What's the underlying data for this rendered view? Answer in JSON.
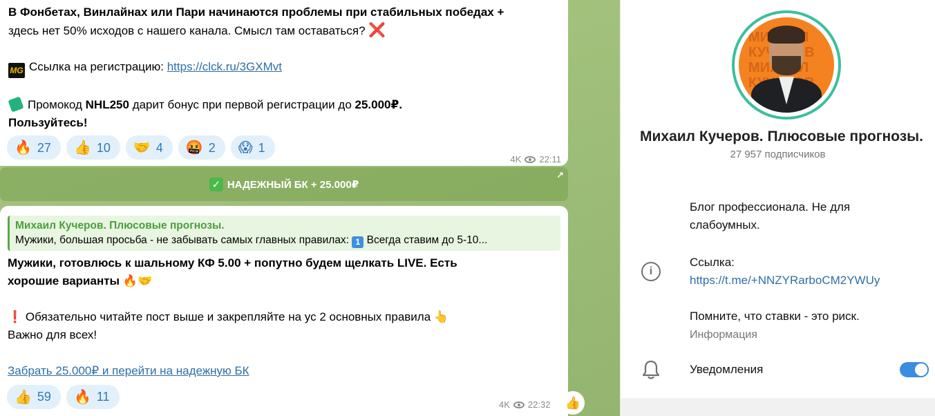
{
  "message1": {
    "line1": "В Фонбетах, Винлайнах или Пари начинаются проблемы при стабильных победах +",
    "line2": "здесь нет 50% исходов с нашего канала. Смысл там оставаться?",
    "cross_icon": "❌",
    "logo_text": "MG",
    "registration_label": "Ссылка на регистрацию:",
    "registration_link": "https://clck.ru/3GXMvt",
    "promo_prefix": "Промокод",
    "promo_code": "NHL250",
    "promo_middle": "дарит бонус при первой регистрации до",
    "promo_amount": "25.000₽.",
    "promo_end": "Пользуйтесь!",
    "reactions": [
      {
        "icon": "🔥",
        "count": "27"
      },
      {
        "icon": "👍",
        "count": "10"
      },
      {
        "icon": "🤝",
        "count": "4"
      },
      {
        "icon": "🤬",
        "count": "2"
      },
      {
        "icon": "😱",
        "count": "1"
      }
    ],
    "views": "4K",
    "time": "22:11"
  },
  "inline_button": {
    "label": "НАДЕЖНЫЙ БК + 25.000₽",
    "check_icon": "✓",
    "arrow_icon": "↗"
  },
  "message2": {
    "reply_author": "Михаил Кучеров. Плюсовые прогнозы.",
    "reply_text_a": "Мужики, большая просьба - не забывать самых главных правилах:",
    "reply_keycap": "1",
    "reply_text_b": "Всегда ставим до 5-10...",
    "line1": "Мужики, готовлюсь к шальному КФ 5.00 + попутно будем щелкать LIVE. Есть",
    "line2": "хорошие варианты",
    "line2_emoji": "🔥🤝",
    "excl_icon": "❗",
    "line3": "Обязательно читайте пост выше и закрепляйте на ус 2 основных правила",
    "line3_emoji": "👆",
    "line4": "Важно для всех!",
    "cta_link": "Забрать 25.000₽ и перейти на надежную БК",
    "reactions": [
      {
        "icon": "👍",
        "count": "59"
      },
      {
        "icon": "🔥",
        "count": "11"
      }
    ],
    "views": "4K",
    "time": "22:32",
    "quick_reaction": "👍"
  },
  "panel": {
    "avatar_watermark": [
      "МИХАИЛ",
      "КУЧЕРОВ",
      "МИХАИЛ",
      "КУЧЕРОВ"
    ],
    "channel_name": "Михаил Кучеров. Плюсовые прогнозы.",
    "subscribers": "27 957 подписчиков",
    "description_line1": "Блог профессионала. Не для",
    "description_line2": "слабоумных.",
    "link_label": "Ссылка:",
    "link_url": "https://t.me/+NNZYRarboCM2YWUy",
    "risk_text": "Помните, что ставки - это риск.",
    "info_label": "Информация",
    "notifications_label": "Уведомления",
    "notifications_on": true,
    "colors": {
      "accent": "#3a8de0",
      "ring": "#3bbf9f",
      "avatar_bg": "#f58220"
    }
  }
}
